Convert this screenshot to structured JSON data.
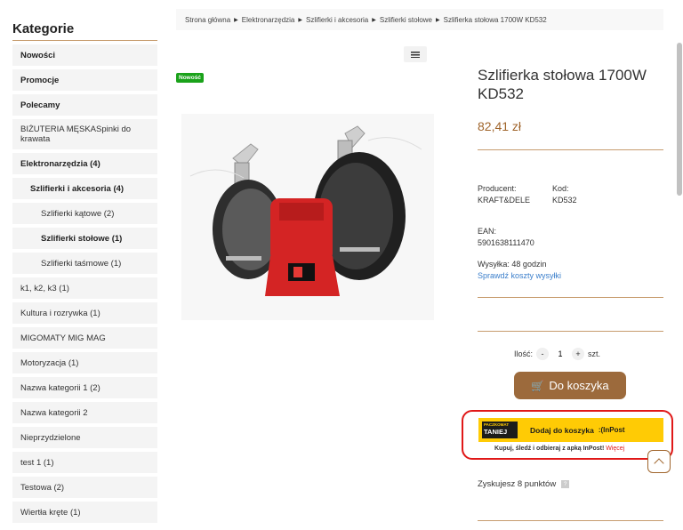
{
  "sidebar": {
    "title": "Kategorie",
    "items": [
      {
        "label": "Nowości",
        "bold": true,
        "level": 0,
        "h": 24
      },
      {
        "label": "Promocje",
        "bold": true,
        "level": 0,
        "h": 24
      },
      {
        "label": "Polecamy",
        "bold": true,
        "level": 0,
        "h": 24
      },
      {
        "label": "BIŻUTERIA MĘSKASpinki do krawata",
        "bold": false,
        "level": 0,
        "h": 34
      },
      {
        "label": "Elektronarzędzia (4)",
        "bold": true,
        "level": 0,
        "h": 24
      },
      {
        "label": "Szlifierki i akcesoria (4)",
        "bold": true,
        "level": 1,
        "h": 24
      },
      {
        "label": "Szlifierki kątowe (2)",
        "bold": false,
        "level": 2,
        "h": 24
      },
      {
        "label": "Szlifierki stołowe (1)",
        "bold": true,
        "level": 2,
        "h": 24
      },
      {
        "label": "Szlifierki taśmowe (1)",
        "bold": false,
        "level": 2,
        "h": 24
      },
      {
        "label": "k1, k2, k3 (1)",
        "bold": false,
        "level": 0,
        "h": 24
      },
      {
        "label": "Kultura i rozrywka (1)",
        "bold": false,
        "level": 0,
        "h": 24
      },
      {
        "label": "MIGOMATY MIG MAG",
        "bold": false,
        "level": 0,
        "h": 24
      },
      {
        "label": "Motoryzacja (1)",
        "bold": false,
        "level": 0,
        "h": 24
      },
      {
        "label": "Nazwa kategorii 1 (2)",
        "bold": false,
        "level": 0,
        "h": 24
      },
      {
        "label": "Nazwa kategorii 2",
        "bold": false,
        "level": 0,
        "h": 24
      },
      {
        "label": "Nieprzydzielone",
        "bold": false,
        "level": 0,
        "h": 24
      },
      {
        "label": "test 1 (1)",
        "bold": false,
        "level": 0,
        "h": 24
      },
      {
        "label": "Testowa (2)",
        "bold": false,
        "level": 0,
        "h": 24
      },
      {
        "label": "Wiertła kręte (1)",
        "bold": false,
        "level": 0,
        "h": 24
      }
    ]
  },
  "breadcrumb": [
    "Strona główna",
    "Elektronarzędzia",
    "Szlifierki i akcesoria",
    "Szlifierki stołowe",
    "Szlifierka stołowa 1700W KD532"
  ],
  "product": {
    "badge": "Nowość",
    "title": "Szlifierka stołowa 1700W KD532",
    "price": "82,41 zł",
    "producer_label": "Producent:",
    "producer_value": "KRAFT&DELE",
    "code_label": "Kod:",
    "code_value": "KD532",
    "ean_label": "EAN:",
    "ean_value": "5901638111470",
    "shipping": "Wysyłka: 48 godzin",
    "shipping_link": "Sprawdź koszty wysyłki",
    "qty_label": "Ilość:",
    "qty_minus": "-",
    "qty_value": "1",
    "qty_plus": "+",
    "qty_unit": "szt.",
    "cart_label": "Do koszyka",
    "points": "Zyskujesz 8 punktów"
  },
  "inpost": {
    "logo_top": "PACZKOMAT",
    "logo_big": "TANIEJ",
    "button_label": "Dodaj do koszyka",
    "brand": "InPost",
    "sub_text": "Kupuj, śledź i odbieraj z apką InPost!",
    "more": "Więcej"
  },
  "colors": {
    "accent": "#9c6a3c",
    "price": "#a0652c",
    "inpost_yellow": "#ffcb05",
    "highlight_red": "#e01818",
    "badge_green": "#1aa21a"
  }
}
